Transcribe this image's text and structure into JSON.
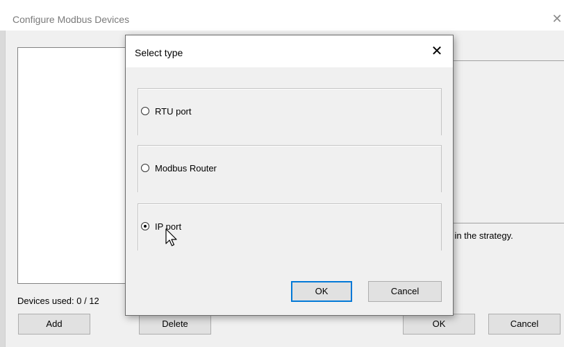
{
  "main_window": {
    "title": "Configure Modbus Devices",
    "close_glyph": "✕",
    "hint_text": "nt in the strategy.",
    "devices_used": "Devices used: 0 / 12",
    "buttons": {
      "add": "Add",
      "delete": "Delete",
      "ok": "OK",
      "cancel": "Cancel"
    }
  },
  "dialog": {
    "title": "Select type",
    "close_glyph": "✕",
    "options": [
      {
        "label": "RTU port",
        "selected": false
      },
      {
        "label": "Modbus Router",
        "selected": false
      },
      {
        "label": "IP port",
        "selected": true
      }
    ],
    "buttons": {
      "ok": "OK",
      "cancel": "Cancel"
    }
  },
  "colors": {
    "window_bg": "#f0f0f0",
    "titlebar_bg": "#ffffff",
    "default_button_border": "#0078d7"
  },
  "icons": {
    "cursor": "mouse-pointer-icon",
    "close": "close-icon"
  }
}
